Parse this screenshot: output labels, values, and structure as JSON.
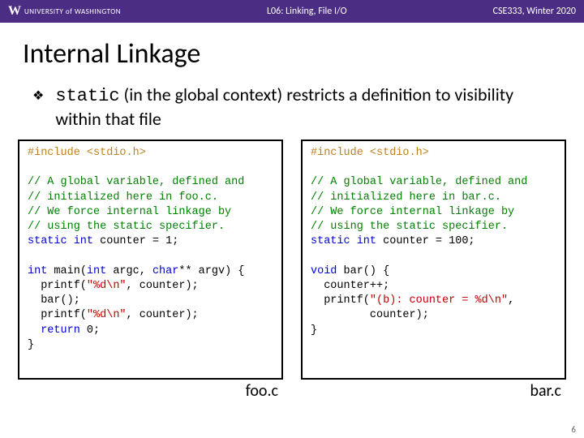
{
  "header": {
    "institution": "UNIVERSITY of WASHINGTON",
    "lecture": "L06:  Linking, File I/O",
    "course": "CSE333, Winter 2020"
  },
  "title": "Internal Linkage",
  "bullet_glyph": "❖",
  "body": {
    "kw": "static",
    "rest": " (in the global context) restricts a definition to visibility within that file"
  },
  "left": {
    "include": "#include <stdio.h>",
    "com1": "// A global variable, defined and",
    "com2": "// initialized here in foo.c.",
    "com3": "// We force internal linkage by",
    "com4": "// using the static specifier.",
    "decl_kw": "static int",
    "decl_rest": " counter = 1;",
    "fn_kw1": "int",
    "fn_sig1": " main(",
    "fn_kw2": "int",
    "fn_sig2": " argc, ",
    "fn_kw3": "char",
    "fn_sig3": "** argv) {",
    "l1a": "  printf(",
    "l1s": "\"%d\\n\"",
    "l1b": ", counter);",
    "l2": "  bar();",
    "l3a": "  printf(",
    "l3s": "\"%d\\n\"",
    "l3b": ", counter);",
    "l4kw": "  return",
    "l4b": " 0;",
    "close": "}",
    "filename": "foo.c"
  },
  "right": {
    "include": "#include <stdio.h>",
    "com1": "// A global variable, defined and",
    "com2": "// initialized here in bar.c.",
    "com3": "// We force internal linkage by",
    "com4": "// using the static specifier.",
    "decl_kw": "static int",
    "decl_rest": " counter = 100;",
    "fn_kw1": "void",
    "fn_sig1": " bar() {",
    "l1": "  counter++;",
    "l2a": "  printf(",
    "l2s": "\"(b): counter = %d\\n\"",
    "l2b": ",",
    "l3": "         counter);",
    "close": "}",
    "filename": "bar.c"
  },
  "page_number": "6"
}
